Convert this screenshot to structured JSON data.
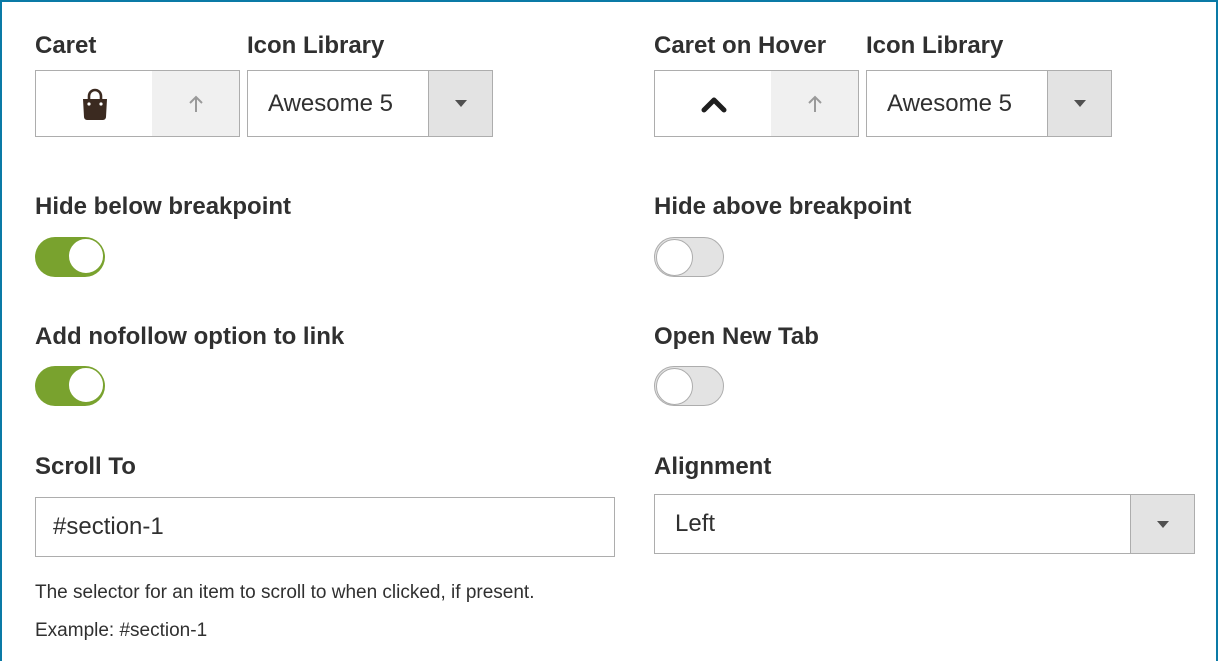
{
  "caret": {
    "label": "Caret",
    "icon": "shopping-bag-icon",
    "up_icon": "arrow-up-icon"
  },
  "caret_library": {
    "label": "Icon Library",
    "value": "Awesome 5"
  },
  "caret_hover": {
    "label": "Caret on Hover",
    "icon": "chevron-up-icon",
    "up_icon": "arrow-up-icon"
  },
  "caret_hover_library": {
    "label": "Icon Library",
    "value": "Awesome 5"
  },
  "hide_below": {
    "label": "Hide below breakpoint",
    "enabled": true
  },
  "hide_above": {
    "label": "Hide above breakpoint",
    "enabled": false
  },
  "nofollow": {
    "label": "Add nofollow option to link",
    "enabled": true
  },
  "open_new_tab": {
    "label": "Open New Tab",
    "enabled": false
  },
  "scroll_to": {
    "label": "Scroll To",
    "value": "#section-1",
    "note": "The selector for an item to scroll to when clicked, if present. Example: #section-1"
  },
  "alignment": {
    "label": "Alignment",
    "value": "Left"
  },
  "colors": {
    "frame": "#0a7aa6",
    "toggle_on": "#79a22e",
    "toggle_off": "#e3e3e3"
  }
}
